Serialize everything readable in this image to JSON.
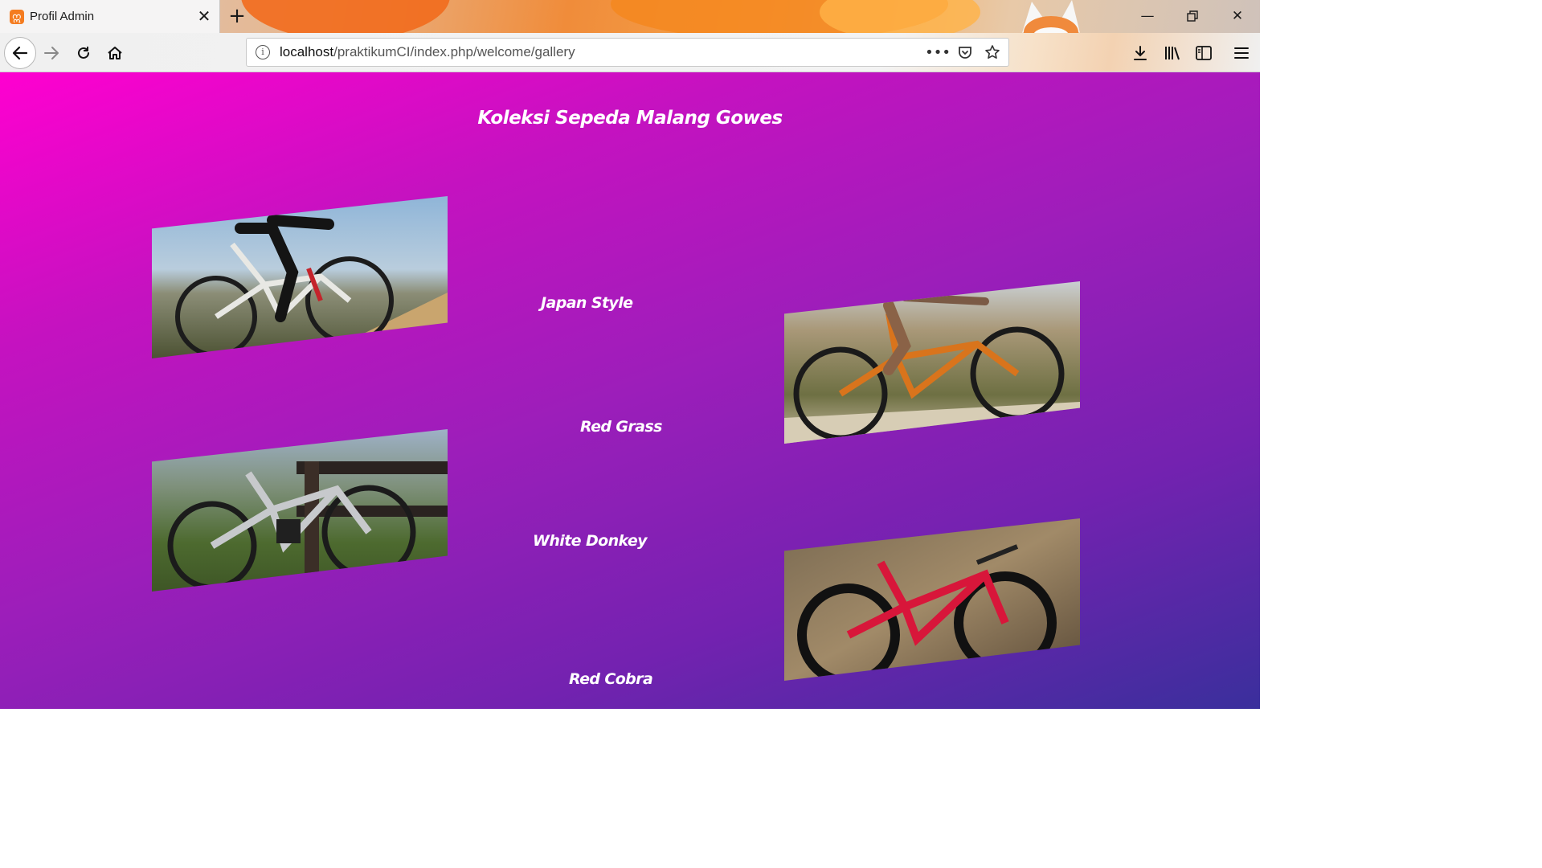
{
  "browser": {
    "tab_title": "Profil Admin",
    "tab_favicon": "xampp-icon",
    "url_host": "localhost",
    "url_path": "/praktikumCI/index.php/welcome/gallery"
  },
  "page": {
    "title": "Koleksi Sepeda Malang Gowes",
    "gallery": [
      {
        "caption": "Japan Style"
      },
      {
        "caption": "Red Grass"
      },
      {
        "caption": "White Donkey"
      },
      {
        "caption": "Red Cobra"
      }
    ]
  },
  "colors": {
    "gradient_start": "#ff00d0",
    "gradient_end": "#3a2f9c",
    "caption_text": "#ffffff"
  }
}
